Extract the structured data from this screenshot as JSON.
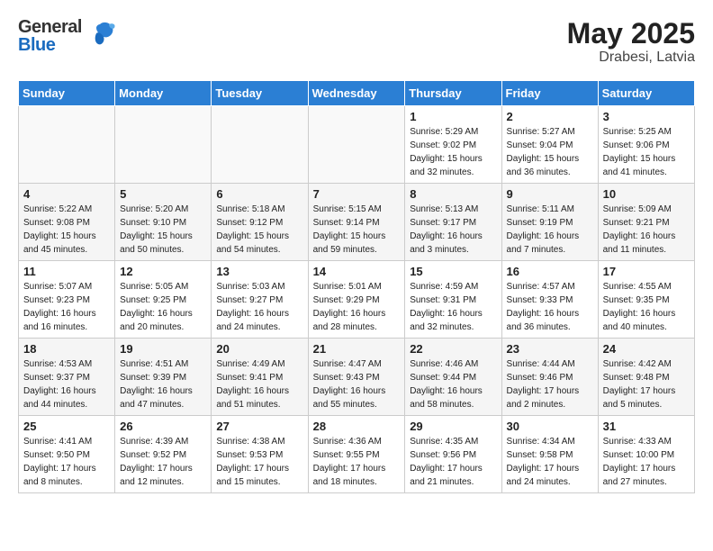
{
  "header": {
    "logo_general": "General",
    "logo_blue": "Blue",
    "title": "May 2025",
    "subtitle": "Drabesi, Latvia"
  },
  "calendar": {
    "weekdays": [
      "Sunday",
      "Monday",
      "Tuesday",
      "Wednesday",
      "Thursday",
      "Friday",
      "Saturday"
    ],
    "weeks": [
      [
        {
          "day": "",
          "details": ""
        },
        {
          "day": "",
          "details": ""
        },
        {
          "day": "",
          "details": ""
        },
        {
          "day": "",
          "details": ""
        },
        {
          "day": "1",
          "details": "Sunrise: 5:29 AM\nSunset: 9:02 PM\nDaylight: 15 hours\nand 32 minutes."
        },
        {
          "day": "2",
          "details": "Sunrise: 5:27 AM\nSunset: 9:04 PM\nDaylight: 15 hours\nand 36 minutes."
        },
        {
          "day": "3",
          "details": "Sunrise: 5:25 AM\nSunset: 9:06 PM\nDaylight: 15 hours\nand 41 minutes."
        }
      ],
      [
        {
          "day": "4",
          "details": "Sunrise: 5:22 AM\nSunset: 9:08 PM\nDaylight: 15 hours\nand 45 minutes."
        },
        {
          "day": "5",
          "details": "Sunrise: 5:20 AM\nSunset: 9:10 PM\nDaylight: 15 hours\nand 50 minutes."
        },
        {
          "day": "6",
          "details": "Sunrise: 5:18 AM\nSunset: 9:12 PM\nDaylight: 15 hours\nand 54 minutes."
        },
        {
          "day": "7",
          "details": "Sunrise: 5:15 AM\nSunset: 9:14 PM\nDaylight: 15 hours\nand 59 minutes."
        },
        {
          "day": "8",
          "details": "Sunrise: 5:13 AM\nSunset: 9:17 PM\nDaylight: 16 hours\nand 3 minutes."
        },
        {
          "day": "9",
          "details": "Sunrise: 5:11 AM\nSunset: 9:19 PM\nDaylight: 16 hours\nand 7 minutes."
        },
        {
          "day": "10",
          "details": "Sunrise: 5:09 AM\nSunset: 9:21 PM\nDaylight: 16 hours\nand 11 minutes."
        }
      ],
      [
        {
          "day": "11",
          "details": "Sunrise: 5:07 AM\nSunset: 9:23 PM\nDaylight: 16 hours\nand 16 minutes."
        },
        {
          "day": "12",
          "details": "Sunrise: 5:05 AM\nSunset: 9:25 PM\nDaylight: 16 hours\nand 20 minutes."
        },
        {
          "day": "13",
          "details": "Sunrise: 5:03 AM\nSunset: 9:27 PM\nDaylight: 16 hours\nand 24 minutes."
        },
        {
          "day": "14",
          "details": "Sunrise: 5:01 AM\nSunset: 9:29 PM\nDaylight: 16 hours\nand 28 minutes."
        },
        {
          "day": "15",
          "details": "Sunrise: 4:59 AM\nSunset: 9:31 PM\nDaylight: 16 hours\nand 32 minutes."
        },
        {
          "day": "16",
          "details": "Sunrise: 4:57 AM\nSunset: 9:33 PM\nDaylight: 16 hours\nand 36 minutes."
        },
        {
          "day": "17",
          "details": "Sunrise: 4:55 AM\nSunset: 9:35 PM\nDaylight: 16 hours\nand 40 minutes."
        }
      ],
      [
        {
          "day": "18",
          "details": "Sunrise: 4:53 AM\nSunset: 9:37 PM\nDaylight: 16 hours\nand 44 minutes."
        },
        {
          "day": "19",
          "details": "Sunrise: 4:51 AM\nSunset: 9:39 PM\nDaylight: 16 hours\nand 47 minutes."
        },
        {
          "day": "20",
          "details": "Sunrise: 4:49 AM\nSunset: 9:41 PM\nDaylight: 16 hours\nand 51 minutes."
        },
        {
          "day": "21",
          "details": "Sunrise: 4:47 AM\nSunset: 9:43 PM\nDaylight: 16 hours\nand 55 minutes."
        },
        {
          "day": "22",
          "details": "Sunrise: 4:46 AM\nSunset: 9:44 PM\nDaylight: 16 hours\nand 58 minutes."
        },
        {
          "day": "23",
          "details": "Sunrise: 4:44 AM\nSunset: 9:46 PM\nDaylight: 17 hours\nand 2 minutes."
        },
        {
          "day": "24",
          "details": "Sunrise: 4:42 AM\nSunset: 9:48 PM\nDaylight: 17 hours\nand 5 minutes."
        }
      ],
      [
        {
          "day": "25",
          "details": "Sunrise: 4:41 AM\nSunset: 9:50 PM\nDaylight: 17 hours\nand 8 minutes."
        },
        {
          "day": "26",
          "details": "Sunrise: 4:39 AM\nSunset: 9:52 PM\nDaylight: 17 hours\nand 12 minutes."
        },
        {
          "day": "27",
          "details": "Sunrise: 4:38 AM\nSunset: 9:53 PM\nDaylight: 17 hours\nand 15 minutes."
        },
        {
          "day": "28",
          "details": "Sunrise: 4:36 AM\nSunset: 9:55 PM\nDaylight: 17 hours\nand 18 minutes."
        },
        {
          "day": "29",
          "details": "Sunrise: 4:35 AM\nSunset: 9:56 PM\nDaylight: 17 hours\nand 21 minutes."
        },
        {
          "day": "30",
          "details": "Sunrise: 4:34 AM\nSunset: 9:58 PM\nDaylight: 17 hours\nand 24 minutes."
        },
        {
          "day": "31",
          "details": "Sunrise: 4:33 AM\nSunset: 10:00 PM\nDaylight: 17 hours\nand 27 minutes."
        }
      ]
    ]
  }
}
